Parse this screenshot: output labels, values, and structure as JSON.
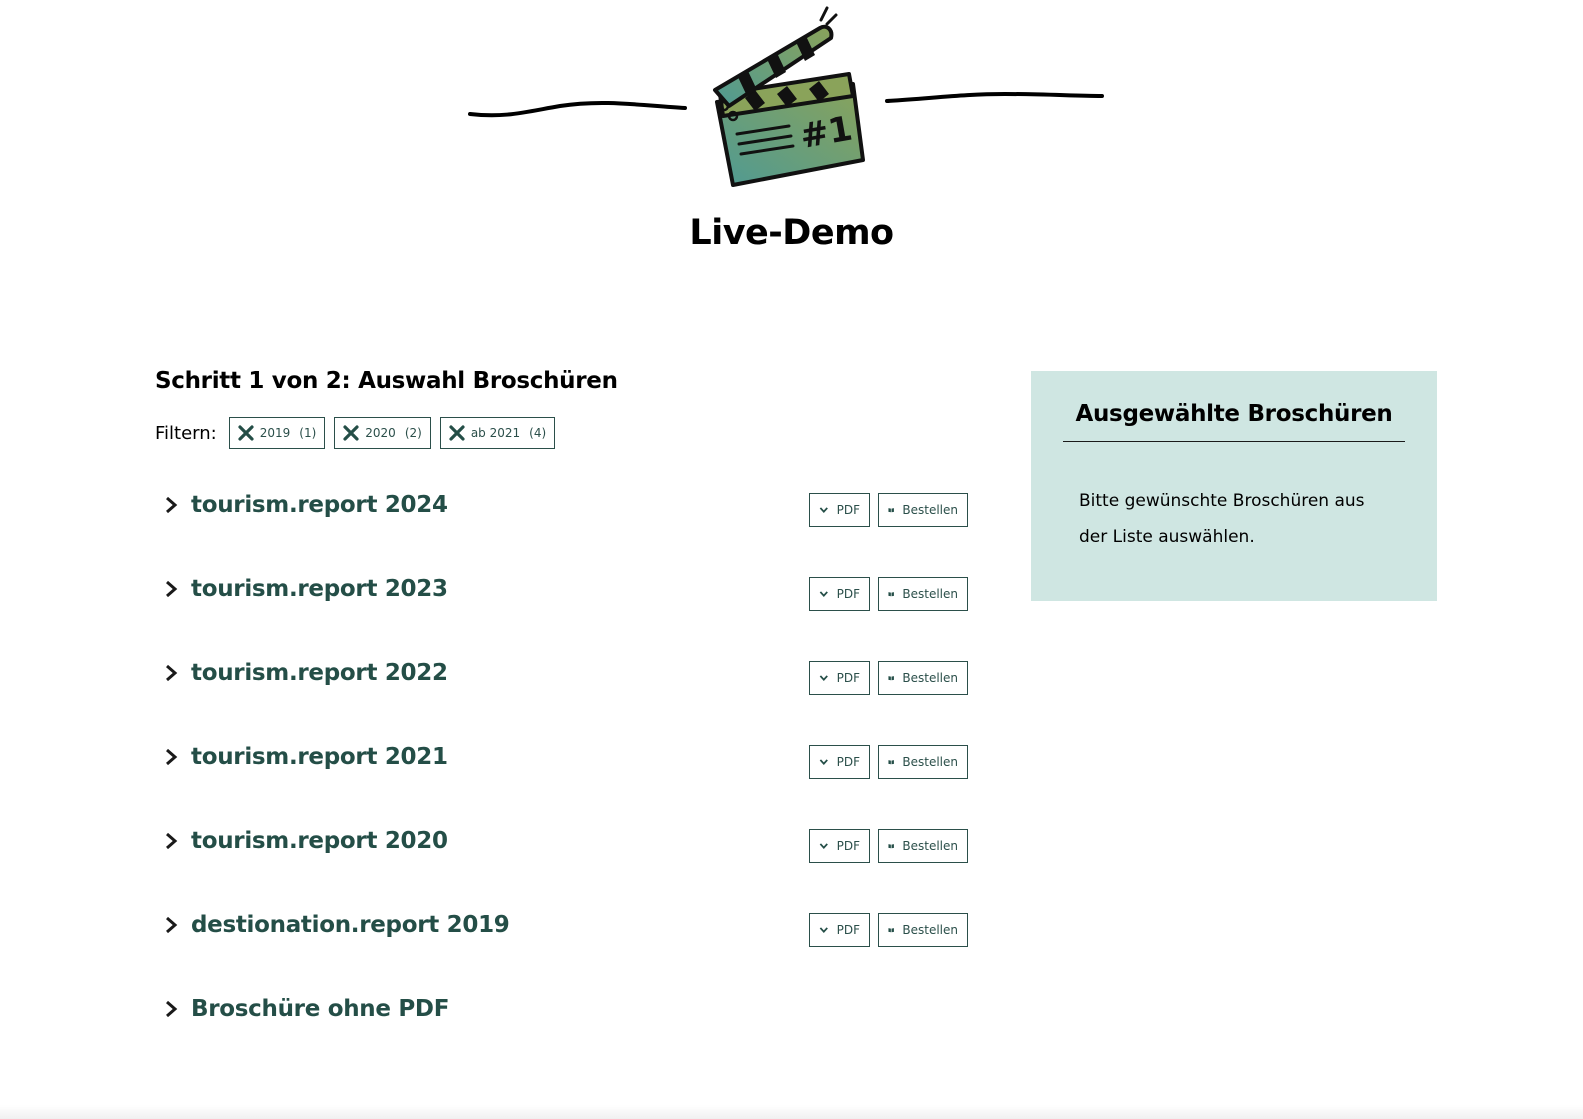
{
  "header": {
    "title": "Live-Demo",
    "logo_icon": "clapperboard-icon",
    "logo_text": "#1"
  },
  "step": {
    "title": "Schritt 1 von 2: Auswahl Broschüren"
  },
  "filters": {
    "label": "Filtern:",
    "chips": [
      {
        "label": "2019",
        "count": "(1)"
      },
      {
        "label": "2020",
        "count": "(2)"
      },
      {
        "label": "ab 2021",
        "count": "(4)"
      }
    ]
  },
  "brochures": [
    {
      "title": "tourism.report 2024",
      "pdf_label": "PDF",
      "order_label": "Bestellen"
    },
    {
      "title": "tourism.report 2023",
      "pdf_label": "PDF",
      "order_label": "Bestellen"
    },
    {
      "title": "tourism.report 2022",
      "pdf_label": "PDF",
      "order_label": "Bestellen"
    },
    {
      "title": "tourism.report 2021",
      "pdf_label": "PDF",
      "order_label": "Bestellen"
    },
    {
      "title": "tourism.report 2020",
      "pdf_label": "PDF",
      "order_label": "Bestellen"
    },
    {
      "title": "destionation.report 2019",
      "pdf_label": "PDF",
      "order_label": "Bestellen"
    },
    {
      "title": "Broschüre ohne PDF"
    }
  ],
  "panel": {
    "title": "Ausgewählte Broschüren",
    "text": "Bitte gewünschte Broschüren aus der Liste auswählen."
  },
  "colors": {
    "accent": "#244e47",
    "border": "#2b4f4a",
    "panel_bg": "#cfe6e2",
    "logo_teal": "#4f9a93",
    "logo_olive": "#8aa35a"
  }
}
